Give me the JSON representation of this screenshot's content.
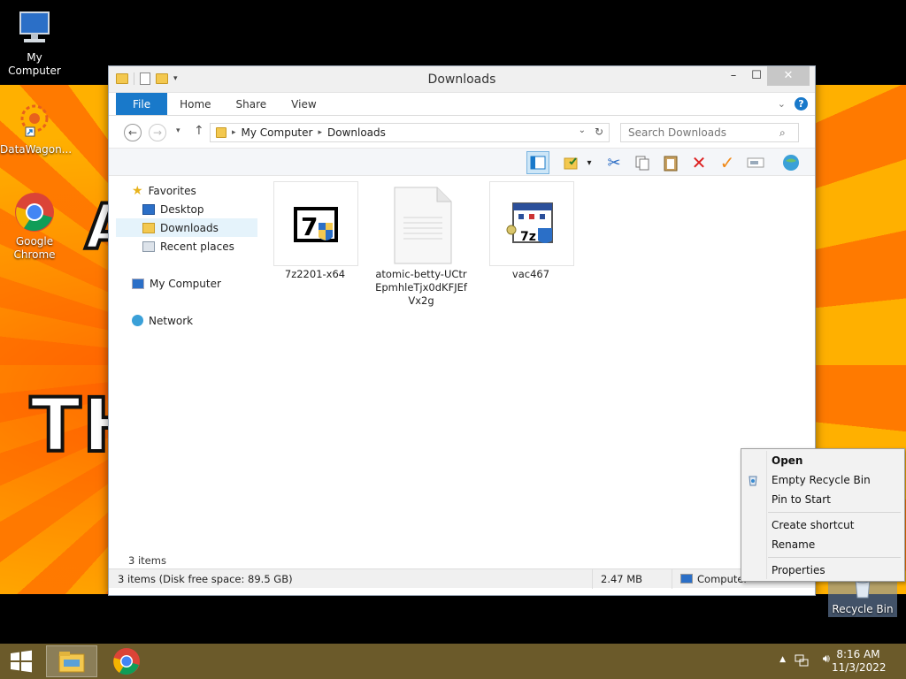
{
  "desktop": {
    "icons": [
      {
        "label": "My Computer"
      },
      {
        "label": "DataWagon..."
      },
      {
        "label": "Google Chrome"
      },
      {
        "label": "Recycle Bin"
      }
    ]
  },
  "window": {
    "title": "Downloads",
    "controls": {
      "minimize": "–",
      "maximize": "☐",
      "close": "✕"
    },
    "ribbon_tabs": [
      "File",
      "Home",
      "Share",
      "View"
    ],
    "address": {
      "root": "My Computer",
      "current": "Downloads"
    },
    "search_placeholder": "Search Downloads"
  },
  "navpane": {
    "favorites": "Favorites",
    "items": [
      "Desktop",
      "Downloads",
      "Recent places"
    ],
    "my_computer": "My Computer",
    "network": "Network"
  },
  "files": [
    {
      "name": "7z2201-x64"
    },
    {
      "name": "atomic-betty-UCtrEpmhleTjx0dKFJEfVx2g"
    },
    {
      "name": "vac467"
    }
  ],
  "status": {
    "items_count": "3 items",
    "detail": "3 items (Disk free space: 89.5 GB)",
    "size": "2.47 MB",
    "location": "Computer"
  },
  "context_menu": {
    "items": [
      "Open",
      "Empty Recycle Bin",
      "Pin to Start",
      "Create shortcut",
      "Rename",
      "Properties"
    ]
  },
  "taskbar": {
    "time": "8:16 AM",
    "date": "11/3/2022"
  },
  "colors": {
    "accent": "#1979ca",
    "taskbar": "#6b5a2a",
    "wallpaper": "#ffa500"
  }
}
